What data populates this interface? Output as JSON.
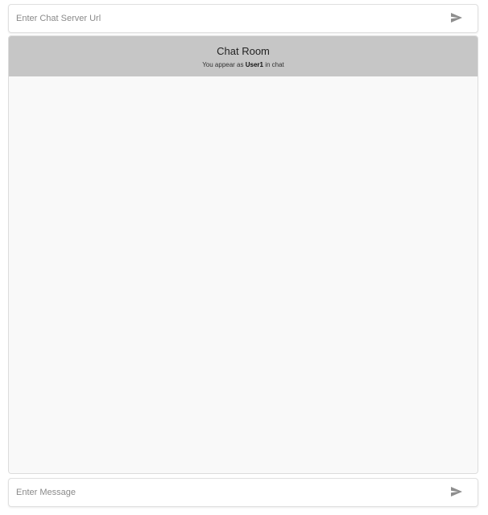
{
  "server_bar": {
    "placeholder": "Enter Chat Server Url",
    "value": "",
    "send_icon": "send-icon"
  },
  "chat_room": {
    "title": "Chat Room",
    "subtitle_prefix": "You appear as ",
    "username": "User1",
    "subtitle_suffix": " in chat",
    "messages": []
  },
  "message_bar": {
    "placeholder": "Enter Message",
    "value": "",
    "send_icon": "send-icon"
  },
  "colors": {
    "header_bg": "#c6c6c6",
    "chat_bg": "#f9f9f9",
    "icon": "#8e8e8e"
  }
}
